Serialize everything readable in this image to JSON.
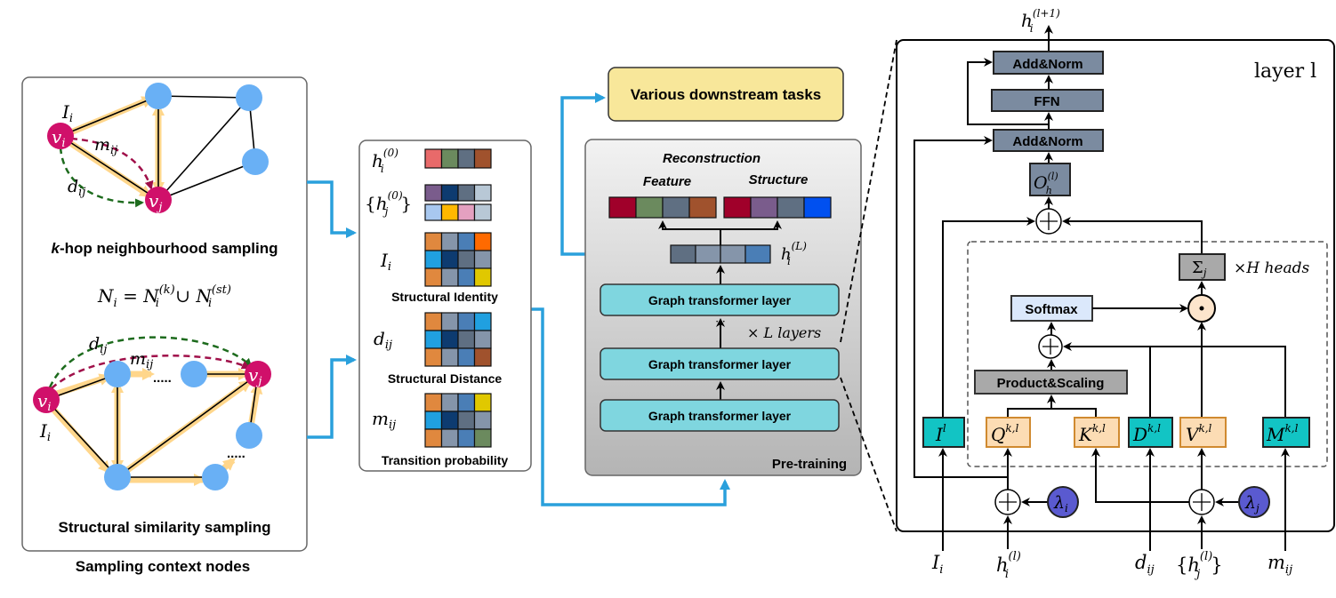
{
  "left": {
    "caption": "Sampling context nodes",
    "khop_k": "k",
    "khop_rest": "-hop neighbourhood sampling",
    "structural_label": "Structural similarity sampling",
    "equation": {
      "lhs": "N",
      "lhs_sub": "i",
      "eq": " = ",
      "n1": "N",
      "n1_sup": "(k)",
      "n1_sub": "i",
      "cup": " ∪ ",
      "n2": "N",
      "n2_sup": "(st)",
      "n2_sub": "i"
    },
    "node_vi": {
      "b": "v",
      "sub": "i"
    },
    "node_vj": {
      "b": "v",
      "sub": "j"
    },
    "I": {
      "b": "I",
      "sub": "i"
    },
    "m": {
      "b": "m",
      "sub": "ij"
    },
    "d": {
      "b": "d",
      "sub": "ij"
    },
    "dots": "....."
  },
  "features": {
    "hi0": {
      "b": "h",
      "sub": "i",
      "sup": "(0)",
      "colors": [
        "#e86a6a",
        "#6b8a5e",
        "#5f6f82",
        "#a0522d"
      ]
    },
    "hj0": {
      "open": "{",
      "b": "h",
      "sub": "j",
      "sup": "(0)",
      "close": "}",
      "rows": [
        [
          "#7a5c8c",
          "#0d3b70",
          "#5f6f82",
          "#b8c8d6"
        ],
        [
          "#a8c8f0",
          "#ffb800",
          "#e4a0c0",
          "#b8c8d6"
        ]
      ]
    },
    "Ii": {
      "b": "I",
      "sub": "i",
      "title": "Structural Identity",
      "rows": [
        [
          "#e0883e",
          "#8595aa",
          "#4a7eb6",
          "#ff6a00"
        ],
        [
          "#20a0e0",
          "#0d3b70",
          "#5f6f82",
          "#8595aa"
        ],
        [
          "#e0883e",
          "#8595aa",
          "#4a7eb6",
          "#e0c800"
        ]
      ]
    },
    "dij": {
      "b": "d",
      "sub": "ij",
      "title": "Structural Distance",
      "rows": [
        [
          "#e0883e",
          "#8595aa",
          "#4a7eb6",
          "#20a0e0"
        ],
        [
          "#20a0e0",
          "#0d3b70",
          "#5f6f82",
          "#8595aa"
        ],
        [
          "#e0883e",
          "#8595aa",
          "#4a7eb6",
          "#a0522d"
        ]
      ]
    },
    "mij": {
      "b": "m",
      "sub": "ij",
      "title": "Transition probability",
      "rows": [
        [
          "#e0883e",
          "#8595aa",
          "#4a7eb6",
          "#e0c800"
        ],
        [
          "#20a0e0",
          "#0d3b70",
          "#5f6f82",
          "#8595aa"
        ],
        [
          "#e0883e",
          "#8595aa",
          "#4a7eb6",
          "#6b8a5e"
        ]
      ]
    }
  },
  "pretraining": {
    "downstream": "Various downstream tasks",
    "reconstruction": "Reconstruction",
    "feature": "Feature",
    "structure": "Structure",
    "feature_colors": [
      "#a0002a",
      "#6b8a5e",
      "#5f6f82",
      "#a0522d"
    ],
    "structure_colors": [
      "#a0002a",
      "#7a5c8c",
      "#5f6f82",
      "#0050f0"
    ],
    "hL": {
      "b": "h",
      "sub": "i",
      "sup": "(L)",
      "colors": [
        "#5f6f82",
        "#8595aa",
        "#8595aa",
        "#4a7eb6"
      ]
    },
    "layer_label": "Graph transformer layer",
    "dots": "···",
    "times_layers": "× L layers",
    "title": "Pre-training"
  },
  "layer": {
    "title": "layer l",
    "output": {
      "b": "h",
      "sub": "i",
      "sup": "(l+1)"
    },
    "add_norm": "Add&Norm",
    "ffn": "FFN",
    "O": {
      "b": "O",
      "sub": "h",
      "sup": "(l)"
    },
    "sigma": {
      "b": "Σ",
      "sub": "j"
    },
    "heads": "×H  heads",
    "softmax": "Softmax",
    "product_scaling": "Product&Scaling",
    "boxes": {
      "I": {
        "b": "I",
        "sup": "l"
      },
      "Q": {
        "b": "Q",
        "sup": "k,l"
      },
      "K": {
        "b": "K",
        "sup": "k,l"
      },
      "D": {
        "b": "D",
        "sup": "k,l"
      },
      "V": {
        "b": "V",
        "sup": "k,l"
      },
      "M": {
        "b": "M",
        "sup": "k,l"
      }
    },
    "lambda_i": {
      "b": "λ",
      "sub": "i"
    },
    "lambda_j": {
      "b": "λ",
      "sub": "j"
    },
    "inputs": {
      "Ii": {
        "b": "I",
        "sub": "i"
      },
      "hi": {
        "b": "h",
        "sub": "i",
        "sup": "(l)"
      },
      "dij": {
        "b": "d",
        "sub": "ij"
      },
      "hj": {
        "open": "{",
        "b": "h",
        "sub": "j",
        "sup": "(l)",
        "close": "}"
      },
      "mij": {
        "b": "m",
        "sub": "ij"
      }
    },
    "colors": {
      "norm": "#7b8ba0",
      "teal": "#12c4c4",
      "orange": "#fcdcb4",
      "lambda": "#5a5ad0",
      "softmax": "#dbe8fb",
      "gray": "#a9a9a9"
    }
  }
}
